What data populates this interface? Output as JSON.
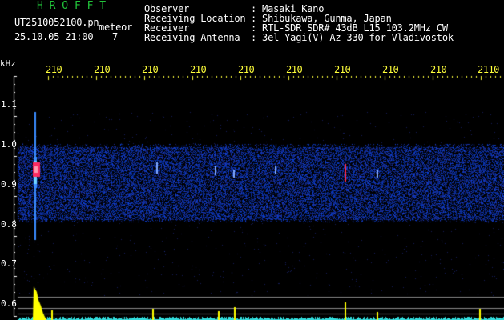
{
  "header": {
    "program": "H R O F F T",
    "filename": "UT2510052100.pn",
    "tag": "meteor",
    "date_time": "25.10.05 21:00",
    "counter": "7_",
    "fields": [
      {
        "label": "Observer",
        "value": ": Masaki Kano"
      },
      {
        "label": "Receiving Location",
        "value": ": Shibukawa, Gunma, Japan"
      },
      {
        "label": "Receiver",
        "value": ": RTL-SDR SDR# 43dB L15 103.2MHz CW"
      },
      {
        "label": "Receiving Antenna",
        "value": ": 3el Yagi(V) Az 330 for Vladivostok"
      }
    ]
  },
  "unit_label": "kHz",
  "time_labels": [
    "210",
    "210",
    "210",
    "210",
    "210",
    "210",
    "210",
    "210",
    "210",
    "2110"
  ],
  "freq_labels": [
    "1.1",
    "1.0",
    "0.9",
    "0.8",
    "0.7",
    "0.6"
  ],
  "colors": {
    "background": "#000000",
    "header_text": "#ffffff",
    "program_green": "#21c43a",
    "time_label_yellow": "#ffff3a",
    "noise_blue": "#2233cc",
    "meteor_red": "#ff3060",
    "spectrum_yellow": "#ffff00",
    "spectrum_cyan": "#33dddd"
  }
}
